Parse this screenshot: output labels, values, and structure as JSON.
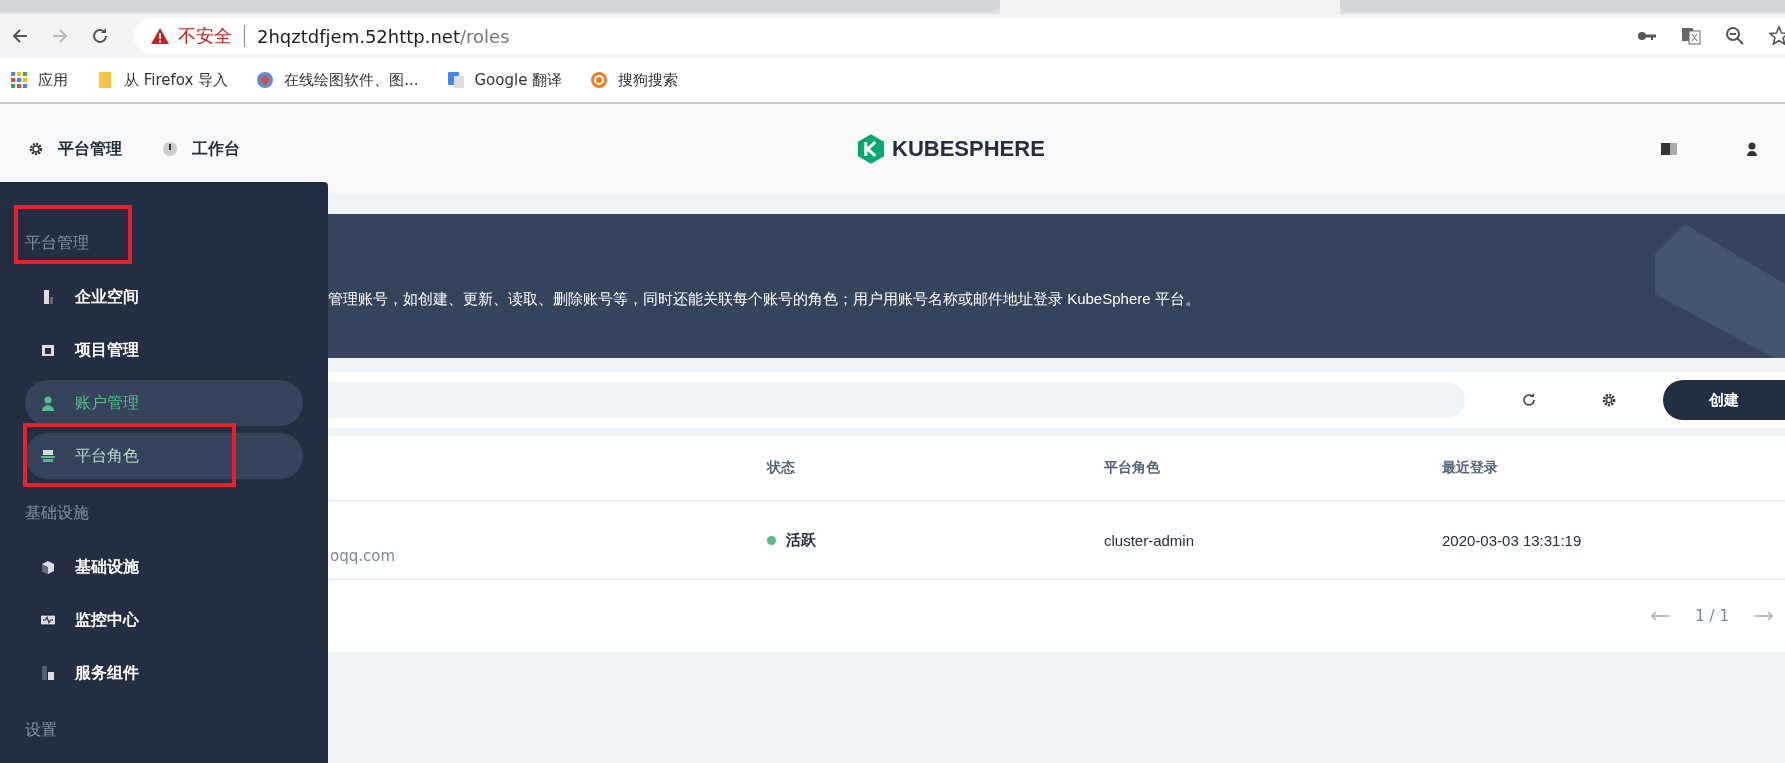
{
  "browser": {
    "tabs": [
      {
        "selected": false
      },
      {
        "selected": true
      },
      {
        "selected": false
      }
    ],
    "security_label": "不安全",
    "host": "2hqztdfjem.52http.net",
    "path": "/roles",
    "bookmarks": [
      {
        "label": "应用"
      },
      {
        "label": "从 Firefox 导入"
      },
      {
        "label": "在线绘图软件、图..."
      },
      {
        "label": "Google 翻译"
      },
      {
        "label": "搜狗搜索"
      }
    ]
  },
  "header": {
    "nav": [
      {
        "label": "平台管理"
      },
      {
        "label": "工作台"
      }
    ],
    "logo": "KUBESPHERE"
  },
  "sidebar": {
    "sections": [
      {
        "title": "平台管理",
        "items": [
          {
            "label": "企业空间",
            "selected": false,
            "hovered": false
          },
          {
            "label": "项目管理",
            "selected": false,
            "hovered": false
          },
          {
            "label": "账户管理",
            "selected": true,
            "hovered": false
          },
          {
            "label": "平台角色",
            "selected": false,
            "hovered": true
          }
        ]
      },
      {
        "title": "基础设施",
        "items": [
          {
            "label": "基础设施",
            "selected": false,
            "hovered": false
          },
          {
            "label": "监控中心",
            "selected": false,
            "hovered": false
          },
          {
            "label": "服务组件",
            "selected": false,
            "hovered": false
          }
        ]
      },
      {
        "title": "设置"
      }
    ]
  },
  "banner": {
    "description": "管理账号，如创建、更新、读取、删除账号等，同时还能关联每个账号的角色；用户用账号名称或邮件地址登录 KubeSphere 平台。"
  },
  "toolbar": {
    "create_button": "创建"
  },
  "table": {
    "columns": [
      "状态",
      "平台角色",
      "最近登录"
    ],
    "rows": [
      {
        "email": "oqq.com",
        "status": "活跃",
        "color": "#55bc8a",
        "role": "cluster-admin",
        "last_login": "2020-03-03 13:31:19"
      }
    ]
  },
  "pagination": {
    "page": "1 / 1"
  }
}
